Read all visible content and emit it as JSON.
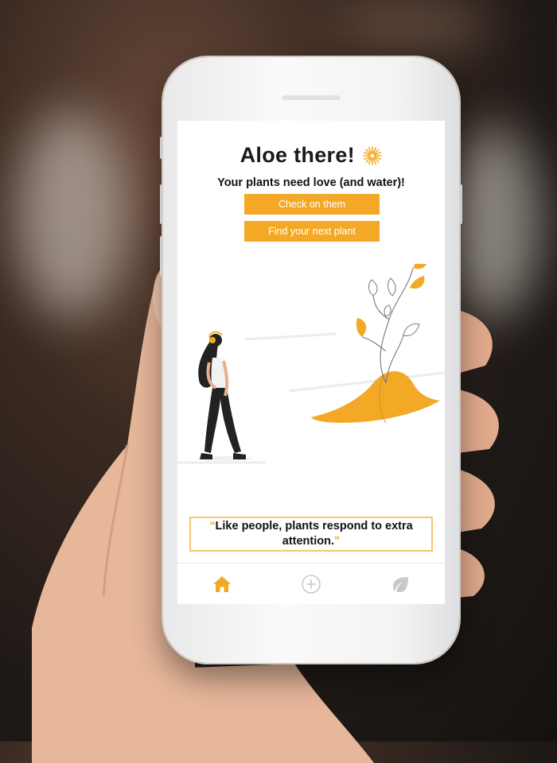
{
  "app": {
    "title": "Aloe there!",
    "subtitle": "Your plants need love (and water)!"
  },
  "actions": {
    "check_label": "Check on them",
    "find_label": "Find your next plant"
  },
  "quote": {
    "open_mark": "“",
    "text": "Like people, plants respond to extra attention.",
    "close_mark": "”"
  },
  "nav": {
    "items": [
      {
        "icon": "home-icon",
        "active": true
      },
      {
        "icon": "plus-circle-icon",
        "active": false
      },
      {
        "icon": "leaf-icon",
        "active": false
      }
    ]
  },
  "colors": {
    "accent": "#f4a926",
    "quote_border": "#f4c770",
    "inactive_icon": "#c9c9c9"
  }
}
